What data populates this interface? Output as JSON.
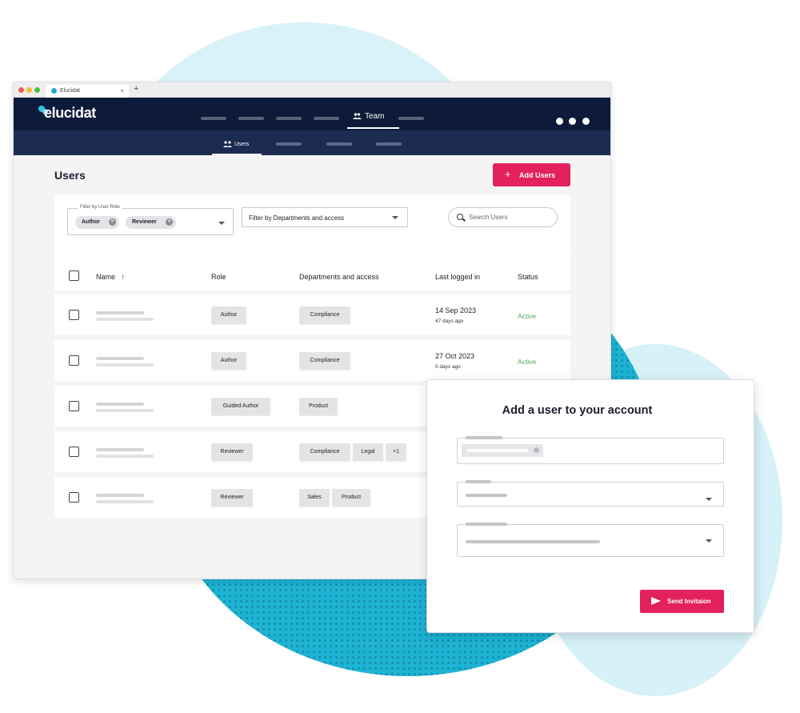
{
  "browser": {
    "tab_title": "Elucidat",
    "tab_close": "×",
    "new_tab": "+"
  },
  "topnav": {
    "logo": "elucidat",
    "active_item": "Team",
    "icons": [
      "globe-icon",
      "help-icon",
      "user-icon"
    ]
  },
  "subnav": {
    "active_item": "Users"
  },
  "page": {
    "title": "Users",
    "add_button": "Add Users"
  },
  "filters": {
    "role_label": "Filter by User Role",
    "role_chips": [
      "Author",
      "Reviewer"
    ],
    "departments": "Filter by Departments and access",
    "search_placeholder": "Search Users"
  },
  "table": {
    "columns": [
      "Name",
      "Role",
      "Departments and access",
      "Last logged in",
      "Status"
    ],
    "sort_indicator": "↑",
    "rows": [
      {
        "role": "Author",
        "departments": [
          "Compliance"
        ],
        "last_logged": "14 Sep 2023",
        "ago": "47 days ago",
        "status": "Active"
      },
      {
        "role": "Author",
        "departments": [
          "Compliance"
        ],
        "last_logged": "27 Oct 2023",
        "ago": "5 days ago",
        "status": "Active"
      },
      {
        "role": "Guided Author",
        "departments": [
          "Product"
        ],
        "last_logged": "",
        "ago": "",
        "status": ""
      },
      {
        "role": "Reviewer",
        "departments": [
          "Compliance",
          "Legal",
          "+1"
        ],
        "last_logged": "",
        "ago": "",
        "status": ""
      },
      {
        "role": "Reviewer",
        "departments": [
          "Sales",
          "Product"
        ],
        "last_logged": "",
        "ago": "",
        "status": ""
      }
    ]
  },
  "modal": {
    "title": "Add a user to your account",
    "send_button": "Send Invitaion"
  },
  "colors": {
    "nav_dark": "#0d1a3a",
    "subnav": "#1c2b52",
    "accent": "#e3215c",
    "active_status": "#4aa760",
    "bg_dots": "#1eb3d3"
  }
}
